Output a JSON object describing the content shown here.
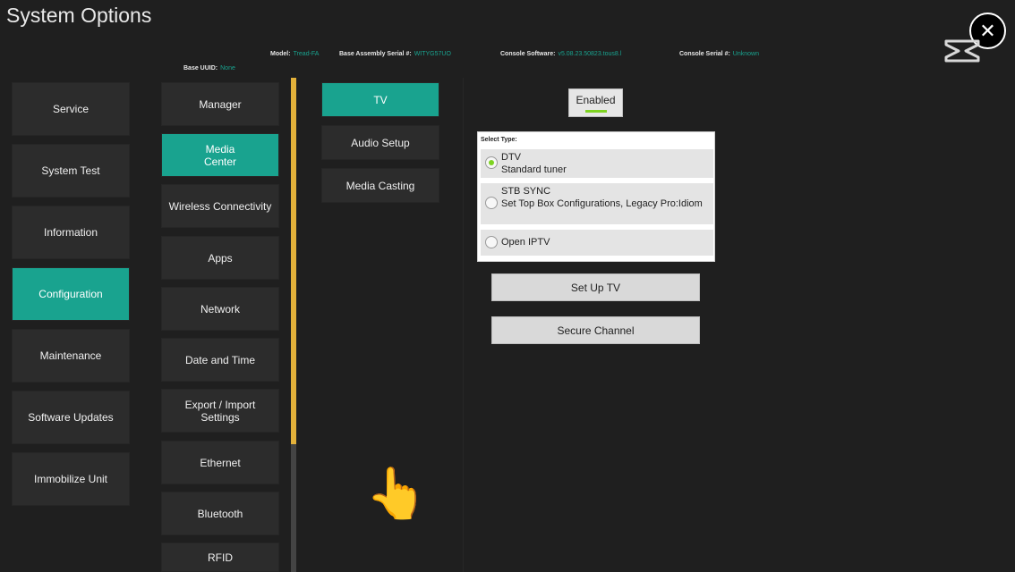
{
  "header": {
    "title": "System Options",
    "model_label": "Model:",
    "model_value": "Tread-FA",
    "base_serial_label": "Base Assembly Serial #:",
    "base_serial_value": "WITYG57UO",
    "console_sw_label": "Console Software:",
    "console_sw_value": "v5.08.23.50823.tous8.l",
    "console_serial_label": "Console Serial #:",
    "console_serial_value": "Unknown",
    "base_uuid_label": "Base UUID:",
    "base_uuid_value": "None",
    "close_glyph": "✕"
  },
  "nav": {
    "primary": [
      {
        "label": "Service",
        "active": false
      },
      {
        "label": "System Test",
        "active": false
      },
      {
        "label": "Information",
        "active": false
      },
      {
        "label": "Configuration",
        "active": true
      },
      {
        "label": "Maintenance",
        "active": false
      },
      {
        "label": "Software Updates",
        "active": false
      },
      {
        "label": "Immobilize Unit",
        "active": false
      }
    ],
    "secondary": [
      {
        "label": "Manager",
        "active": false
      },
      {
        "label": "Media Center",
        "active": true
      },
      {
        "label": "Wireless Connectivity",
        "active": false
      },
      {
        "label": "Apps",
        "active": false
      },
      {
        "label": "Network",
        "active": false
      },
      {
        "label": "Date and Time",
        "active": false
      },
      {
        "label": "Export / Import Settings",
        "active": false
      },
      {
        "label": "Ethernet",
        "active": false
      },
      {
        "label": "Bluetooth",
        "active": false
      },
      {
        "label": "RFID",
        "active": false
      }
    ],
    "tertiary": [
      {
        "label": "TV",
        "active": true
      },
      {
        "label": "Audio Setup",
        "active": false
      },
      {
        "label": "Media Casting",
        "active": false
      }
    ]
  },
  "tv_panel": {
    "enabled_label": "Enabled",
    "select_type_label": "Select Type:",
    "options": [
      {
        "title": "DTV",
        "desc": "Standard tuner",
        "checked": true
      },
      {
        "title": "STB SYNC",
        "desc": "Set Top Box Configurations, Legacy Pro:Idiom",
        "checked": false
      },
      {
        "title": "Open IPTV",
        "desc": "",
        "checked": false
      }
    ],
    "setup_label": "Set Up TV",
    "secure_label": "Secure Channel"
  },
  "cursor_icon": "👆",
  "colors": {
    "accent": "#19a38f",
    "scroll_thumb": "#e3b13a",
    "indicator": "#7ed321"
  }
}
